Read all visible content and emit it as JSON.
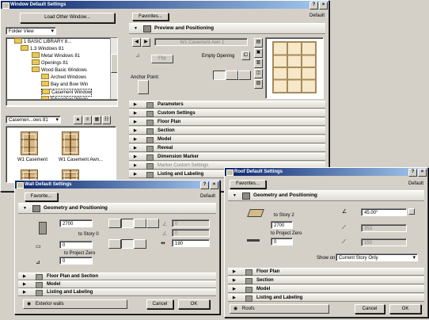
{
  "window_win": {
    "title": "Window Default Settings",
    "load_other": "Load Other Window...",
    "view_select": "Folder View",
    "tree": [
      "1 BASIC LIBRARY 8...",
      "1.3 Windows 81",
      "Metal Windows 81",
      "Openings 81",
      "Wood Basic Windows",
      "Arched Windows",
      "Bay and Bow Win",
      "Casement Window",
      "Edwardian Windo"
    ],
    "bottom_select": "Casemen...ows 81",
    "thumbs": [
      "W1 Casement",
      "W1 Casement Awn..."
    ],
    "favorites": "Favorites...",
    "default_label": "Default",
    "preview_header": "Preview and Positioning",
    "type_name": "W1 Casement Awn 1",
    "empty_opening": "Empty Opening",
    "anchor_point": "Anchor Point:",
    "sections": [
      "Parameters",
      "Custom Settings",
      "Floor Plan",
      "Section",
      "Model",
      "Reveal",
      "Dimension Marker",
      "Marker Custom Settings",
      "Listing and Labeling"
    ]
  },
  "wall_win": {
    "title": "Wall Default Settings",
    "favorites": "Favorite...",
    "default_label": "Default",
    "header": "Geometry and Positioning",
    "height": "2700",
    "to_story": "to Story 0",
    "base_offset": "0",
    "to_project_zero": "to Project Zero",
    "bottom_val": "0",
    "thickness": "190",
    "dis_val_1": "0",
    "dis_val_2": "0",
    "sections": [
      "Floor Plan and Section",
      "Model",
      "Listing and Labeling"
    ],
    "footer_label": "Exterior walls",
    "cancel": "Cancel",
    "ok": "OK"
  },
  "roof_win": {
    "title": "Roof Default Settings",
    "favorites": "Favorites...",
    "default_label": "Default",
    "header": "Geometry and Positioning",
    "to_story": "to Story 2",
    "elevation": "2700",
    "to_project_zero": "to Project Zero",
    "thickness": "0",
    "angle": "45.00°",
    "dis_val_1": "353",
    "dis_val_2": "150",
    "show_on_label": "Show on:",
    "show_on_value": "Current Story Only",
    "sections": [
      "Floor Plan",
      "Section",
      "Model",
      "Listing and Labeling"
    ],
    "footer_label": "Roofs",
    "cancel": "Cancel",
    "ok": "OK"
  }
}
